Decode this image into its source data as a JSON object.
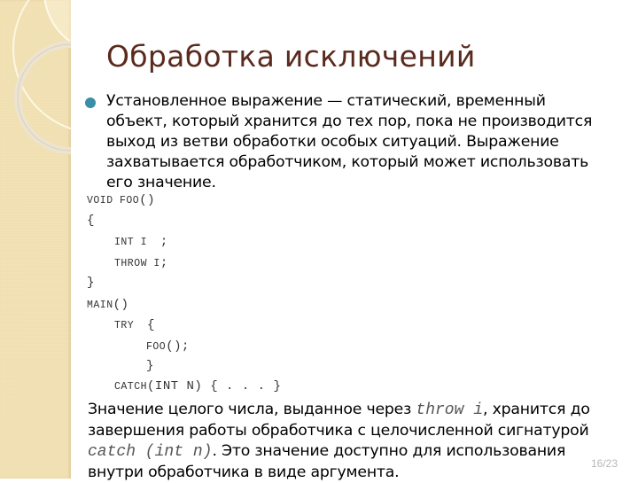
{
  "slide": {
    "title": "Обработка исключений",
    "bullet": {
      "lines": [
        "Установленное выражение — статический, временный",
        "объект, который хранится до тех пор, пока не производится",
        "выход из ветви обработки особых ситуаций. Выражение",
        "захватывается обработчиком, который может использовать",
        "его значение."
      ]
    },
    "code": [
      {
        "kw": "VOID FOO",
        "rest": "()"
      },
      {
        "kw": "",
        "rest": "{"
      },
      {
        "kw": "INT I ",
        "rest": ";"
      },
      {
        "kw": "THROW I",
        "rest": ";"
      },
      {
        "kw": "",
        "rest": "}"
      },
      {
        "kw": "MAIN",
        "rest": "()"
      },
      {
        "kw": "TRY ",
        "rest": "{"
      },
      {
        "kw": "FOO",
        "rest": "();"
      },
      {
        "kw": "",
        "rest": "}"
      },
      {
        "kw": "CATCH",
        "rest": "(INT N) { . . . }"
      }
    ],
    "paragraph2": {
      "line1_pre": "Значение целого числа, выданное через ",
      "line1_code": "throw i",
      "line1_post": ", хранится до",
      "line2": "завершения работы обработчика с целочисленной сигнатурой",
      "line3_code": "catch (int n)",
      "line3_post": ". Это значение доступно для использования",
      "line4": "внутри обработчика в виде аргумента."
    },
    "page_number": "16/23"
  },
  "colors": {
    "title": "#5a2a1e",
    "bullet": "#3a8ea8",
    "sidebar": "#f0dfb0"
  }
}
